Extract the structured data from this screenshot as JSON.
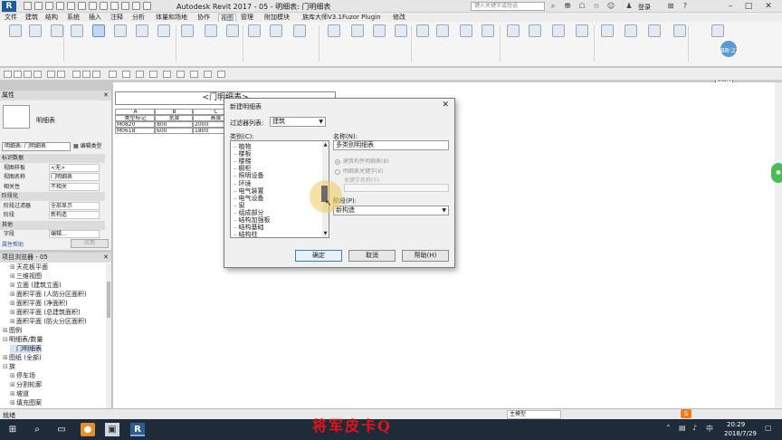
{
  "window": {
    "title": "Autodesk Revit 2017 -   05 - 明细表: 门明细表",
    "search_placeholder": "键入关键字或短语",
    "login_label": "登录"
  },
  "ribbon_tabs": [
    "文件",
    "建筑",
    "结构",
    "系统",
    "插入",
    "注释",
    "分析",
    "体量和场地",
    "协作",
    "视图",
    "管理",
    "附加模块",
    "族库大师V3.1",
    "Fuzor Plugin",
    "修改"
  ],
  "ribbon_active_tab": "视图",
  "avatar": {
    "label": "BB:22"
  },
  "start_box": "Start",
  "properties": {
    "header": "属性",
    "type_name": "明细表",
    "type_select": "明细表: 门明细表",
    "edit_type": "编辑类型",
    "sections": [
      {
        "kind": "section",
        "key": "标识数据"
      },
      {
        "kind": "row",
        "key": "视图样板",
        "value": "<无>"
      },
      {
        "kind": "row",
        "key": "视图名称",
        "value": "门明细表"
      },
      {
        "kind": "row",
        "key": "相关性",
        "value": "不相关"
      },
      {
        "kind": "section",
        "key": "阶段化"
      },
      {
        "kind": "row",
        "key": "阶段过滤器",
        "value": "全部显示"
      },
      {
        "kind": "row",
        "key": "阶段",
        "value": "新构造"
      },
      {
        "kind": "section",
        "key": "其他"
      },
      {
        "kind": "row",
        "key": "字段",
        "value": "编辑..."
      }
    ],
    "help_link": "属性帮助",
    "apply_button": "应用"
  },
  "browser": {
    "header": "项目浏览器 - 05",
    "items": [
      {
        "indent": 1,
        "toggle": "⊞",
        "label": "天花板平面",
        "selected": false
      },
      {
        "indent": 1,
        "toggle": "⊞",
        "label": "三维视图",
        "selected": false
      },
      {
        "indent": 1,
        "toggle": "⊞",
        "label": "立面 (建筑立面)",
        "selected": false
      },
      {
        "indent": 1,
        "toggle": "⊞",
        "label": "面积平面 (人防分区面积)",
        "selected": false
      },
      {
        "indent": 1,
        "toggle": "⊞",
        "label": "面积平面 (净面积)",
        "selected": false
      },
      {
        "indent": 1,
        "toggle": "⊞",
        "label": "面积平面 (总建筑面积)",
        "selected": false
      },
      {
        "indent": 1,
        "toggle": "⊞",
        "label": "面积平面 (防火分区面积)",
        "selected": false
      },
      {
        "indent": 0,
        "toggle": "⊞",
        "label": "图例",
        "selected": false
      },
      {
        "indent": 0,
        "toggle": "⊟",
        "label": "明细表/数量",
        "selected": false
      },
      {
        "indent": 1,
        "toggle": "",
        "label": "门明细表",
        "selected": true
      },
      {
        "indent": 0,
        "toggle": "⊞",
        "label": "图纸 (全部)",
        "selected": false
      },
      {
        "indent": 0,
        "toggle": "⊟",
        "label": "族",
        "selected": false
      },
      {
        "indent": 1,
        "toggle": "⊞",
        "label": "停车场",
        "selected": false
      },
      {
        "indent": 1,
        "toggle": "⊞",
        "label": "分割轮廓",
        "selected": false
      },
      {
        "indent": 1,
        "toggle": "⊞",
        "label": "坡道",
        "selected": false
      },
      {
        "indent": 1,
        "toggle": "⊞",
        "label": "填充图案",
        "selected": false
      }
    ]
  },
  "schedule": {
    "title": "<门明细表>",
    "col_letters": [
      "A",
      "B",
      "C"
    ],
    "headers": [
      "类型标记",
      "宽度",
      "高度"
    ],
    "rows": [
      [
        "M0820",
        "800",
        "2000"
      ],
      [
        "M0618",
        "600",
        "1800"
      ]
    ]
  },
  "dialog": {
    "title": "新建明细表",
    "filter_label": "过滤器列表:",
    "filter_value": "建筑",
    "category_label": "类别(C):",
    "categories": [
      "植物",
      "楼板",
      "楼梯",
      "橱柜",
      "照明设备",
      "环境",
      "电气装置",
      "电气设备",
      "窗",
      "组成部分",
      "结构加强板",
      "结构基础",
      "结构柱"
    ],
    "name_label": "名称(N):",
    "name_value": "多类别明细表",
    "radio_building": "建筑构件明细表(B)",
    "radio_key": "明细表关键字(K)",
    "key_name_label": "关键字名称(Y):",
    "phase_label": "阶段(P):",
    "phase_value": "新构造",
    "ok": "确定",
    "cancel": "取消",
    "help": "帮助(H)"
  },
  "status": {
    "text": "就绪",
    "model": "主模型",
    "watermark": "将军皮卡Q"
  },
  "taskbar": {
    "time": "20:29",
    "date": "2018/7/29"
  }
}
